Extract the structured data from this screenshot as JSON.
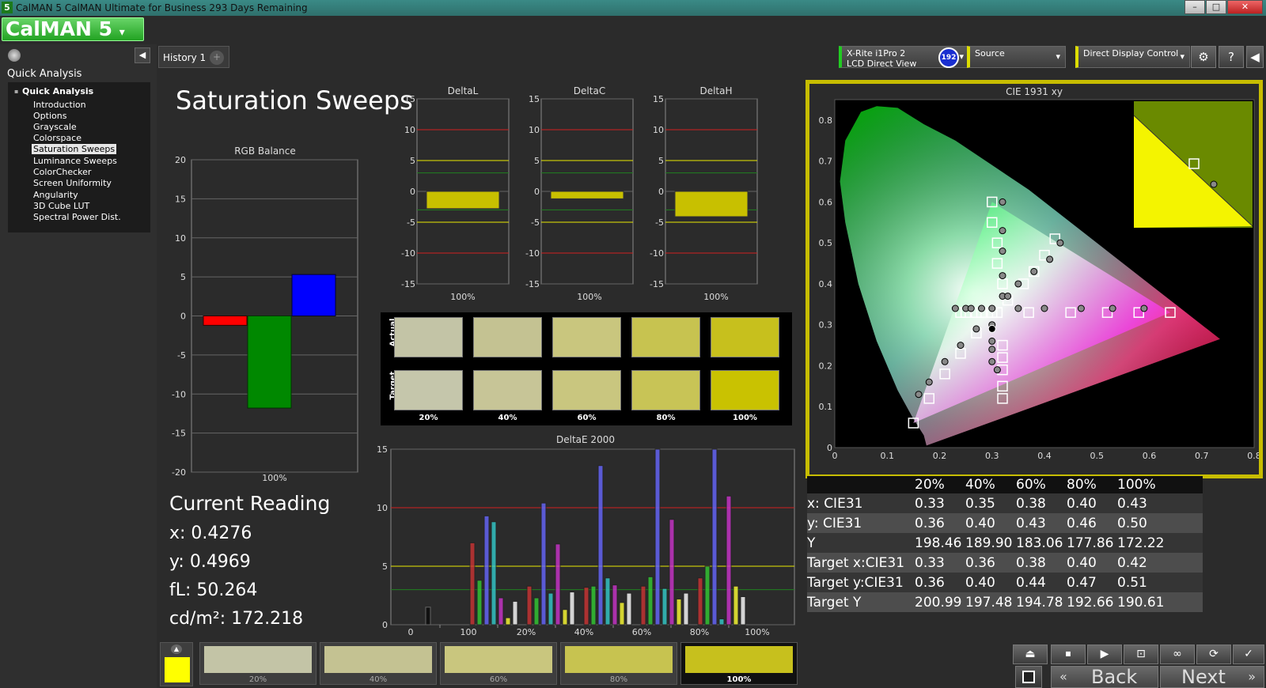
{
  "window": {
    "title": "CalMAN 5 CalMAN Ultimate for Business 293 Days Remaining",
    "icon_label": "5",
    "min_label": "–",
    "max_label": "□",
    "close_label": "✕"
  },
  "app": {
    "logo": "CalMAN 5"
  },
  "sidebar": {
    "header": "Quick Analysis",
    "tree_root": "Quick Analysis",
    "items": [
      "Introduction",
      "Options",
      "Grayscale",
      "Colorspace",
      "Saturation Sweeps",
      "Luminance Sweeps",
      "ColorChecker",
      "Screen Uniformity",
      "Angularity",
      "3D Cube LUT",
      "Spectral Power Dist."
    ],
    "selected": "Saturation Sweeps"
  },
  "tabs": {
    "history": "History 1",
    "add": "+"
  },
  "devices": {
    "meter_line1": "X-Rite i1Pro 2",
    "meter_line2": "LCD Direct View",
    "badge": "192",
    "source": "Source",
    "display": "Direct Display Control"
  },
  "page": {
    "title": "Saturation Sweeps"
  },
  "rgb_balance": {
    "title": "RGB Balance",
    "xlabel": "100%",
    "ticks": [
      "20",
      "15",
      "10",
      "5",
      "0",
      "-5",
      "-10",
      "-15",
      "-20"
    ]
  },
  "delta_charts": {
    "ticks": [
      "15",
      "10",
      "5",
      "0",
      "-5",
      "-10",
      "-15"
    ],
    "L": {
      "title": "DeltaL",
      "xlabel": "100%"
    },
    "C": {
      "title": "DeltaC",
      "xlabel": "100%"
    },
    "H": {
      "title": "DeltaH",
      "xlabel": "100%"
    }
  },
  "swatches": {
    "actual_label": "Actual",
    "target_label": "Target",
    "labels": [
      "20%",
      "40%",
      "60%",
      "80%",
      "100%"
    ],
    "actual_colors": [
      "#c3c4a6",
      "#c4c292",
      "#c9c67e",
      "#c7c350",
      "#c7c01d"
    ],
    "target_colors": [
      "#c5c6ab",
      "#c7c597",
      "#c9c67f",
      "#c8c456",
      "#c9c201"
    ]
  },
  "deltae": {
    "title": "DeltaE 2000",
    "xticks": [
      "0",
      "100",
      "20%",
      "40%",
      "60%",
      "80%",
      "100%"
    ],
    "yticks": [
      "15",
      "10",
      "5",
      "0"
    ]
  },
  "cie": {
    "title": "CIE 1931 xy",
    "xticks": [
      "0",
      "0.1",
      "0.2",
      "0.3",
      "0.4",
      "0.5",
      "0.6",
      "0.7",
      "0.8"
    ],
    "yticks": [
      "0.8",
      "0.7",
      "0.6",
      "0.5",
      "0.4",
      "0.3",
      "0.2",
      "0.1",
      "0"
    ]
  },
  "current_reading": {
    "title": "Current Reading",
    "x": "x: 0.4276",
    "y": "y: 0.4969",
    "fl": "fL: 50.264",
    "cd": "cd/m²: 172.218"
  },
  "table": {
    "headers": [
      "20%",
      "40%",
      "60%",
      "80%",
      "100%"
    ],
    "rows": [
      {
        "label": "x: CIE31",
        "values": [
          "0.33",
          "0.35",
          "0.38",
          "0.40",
          "0.43"
        ]
      },
      {
        "label": "y: CIE31",
        "values": [
          "0.36",
          "0.40",
          "0.43",
          "0.46",
          "0.50"
        ]
      },
      {
        "label": "Y",
        "values": [
          "198.46",
          "189.90",
          "183.06",
          "177.86",
          "172.22"
        ]
      },
      {
        "label": "Target x:CIE31",
        "values": [
          "0.33",
          "0.36",
          "0.38",
          "0.40",
          "0.42"
        ]
      },
      {
        "label": "Target y:CIE31",
        "values": [
          "0.36",
          "0.40",
          "0.44",
          "0.47",
          "0.51"
        ]
      },
      {
        "label": "Target Y",
        "values": [
          "200.99",
          "197.48",
          "194.78",
          "192.66",
          "190.61"
        ]
      }
    ]
  },
  "bottom": {
    "labels": [
      "20%",
      "40%",
      "60%",
      "80%",
      "100%"
    ],
    "colors": [
      "#c3c4a6",
      "#c4c292",
      "#c9c67e",
      "#c7c350",
      "#c7c01d"
    ],
    "current_color": "#ffff00",
    "back": "Back",
    "next": "Next"
  },
  "chart_data": [
    {
      "type": "bar",
      "title": "RGB Balance",
      "categories": [
        "100%"
      ],
      "series": [
        {
          "values": [
            -1.2
          ]
        },
        {
          "values": [
            -11.8
          ]
        },
        {
          "values": [
            5.3
          ]
        }
      ],
      "colors": [
        "#ff0000",
        "#008800",
        "#0000ff"
      ],
      "ylim": [
        -20,
        20
      ]
    },
    {
      "type": "bar",
      "title": "DeltaL",
      "categories": [
        "100%"
      ],
      "values": [
        -2.8
      ],
      "ylim": [
        -15,
        15
      ]
    },
    {
      "type": "bar",
      "title": "DeltaC",
      "categories": [
        "100%"
      ],
      "values": [
        -1.2
      ],
      "ylim": [
        -15,
        15
      ]
    },
    {
      "type": "bar",
      "title": "DeltaH",
      "categories": [
        "100%"
      ],
      "values": [
        -4.1
      ],
      "ylim": [
        -15,
        15
      ]
    },
    {
      "type": "bar",
      "title": "DeltaE 2000",
      "ylim": [
        0,
        15
      ],
      "groups": [
        {
          "values": [
            1.5
          ]
        },
        {
          "values": [
            7.0,
            3.8,
            9.3,
            8.8,
            2.3,
            0.6,
            2.0
          ]
        },
        {
          "values": [
            3.3,
            2.3,
            10.4,
            2.7,
            6.9,
            1.3,
            2.8
          ]
        },
        {
          "values": [
            3.2,
            3.3,
            13.6,
            4.0,
            3.4,
            1.9,
            2.7
          ]
        },
        {
          "values": [
            3.3,
            4.1,
            15.0,
            3.1,
            9.0,
            2.2,
            2.7
          ]
        },
        {
          "values": [
            4.0,
            5.0,
            15.0,
            0.5,
            11.0,
            3.3,
            2.4
          ]
        }
      ],
      "colors": [
        "#cc3333",
        "#33cc33",
        "#6666ff",
        "#33cccc",
        "#cc33cc",
        "#ffff33",
        "#ffffff"
      ]
    },
    {
      "type": "scatter",
      "title": "CIE 1931 xy",
      "xlim": [
        0,
        0.8
      ],
      "ylim": [
        0,
        0.85
      ],
      "gamut": [
        [
          0.64,
          0.33
        ],
        [
          0.3,
          0.6
        ],
        [
          0.15,
          0.06
        ]
      ],
      "targets": [
        [
          0.15,
          0.06
        ],
        [
          0.18,
          0.12
        ],
        [
          0.21,
          0.18
        ],
        [
          0.24,
          0.23
        ],
        [
          0.27,
          0.28
        ],
        [
          0.3,
          0.6
        ],
        [
          0.3,
          0.55
        ],
        [
          0.31,
          0.5
        ],
        [
          0.31,
          0.45
        ],
        [
          0.32,
          0.4
        ],
        [
          0.31,
          0.33
        ],
        [
          0.64,
          0.33
        ],
        [
          0.58,
          0.33
        ],
        [
          0.52,
          0.33
        ],
        [
          0.45,
          0.33
        ],
        [
          0.37,
          0.33
        ],
        [
          0.24,
          0.33
        ],
        [
          0.25,
          0.33
        ],
        [
          0.27,
          0.33
        ],
        [
          0.28,
          0.33
        ],
        [
          0.3,
          0.33
        ],
        [
          0.32,
          0.12
        ],
        [
          0.32,
          0.15
        ],
        [
          0.32,
          0.19
        ],
        [
          0.32,
          0.22
        ],
        [
          0.32,
          0.25
        ],
        [
          0.42,
          0.51
        ],
        [
          0.4,
          0.47
        ],
        [
          0.38,
          0.43
        ],
        [
          0.36,
          0.4
        ],
        [
          0.33,
          0.36
        ]
      ],
      "actuals": [
        [
          0.16,
          0.13
        ],
        [
          0.18,
          0.16
        ],
        [
          0.21,
          0.21
        ],
        [
          0.24,
          0.25
        ],
        [
          0.27,
          0.29
        ],
        [
          0.32,
          0.6
        ],
        [
          0.32,
          0.53
        ],
        [
          0.32,
          0.48
        ],
        [
          0.32,
          0.42
        ],
        [
          0.32,
          0.37
        ],
        [
          0.59,
          0.34
        ],
        [
          0.53,
          0.34
        ],
        [
          0.47,
          0.34
        ],
        [
          0.4,
          0.34
        ],
        [
          0.35,
          0.34
        ],
        [
          0.23,
          0.34
        ],
        [
          0.25,
          0.34
        ],
        [
          0.26,
          0.34
        ],
        [
          0.28,
          0.34
        ],
        [
          0.3,
          0.34
        ],
        [
          0.3,
          0.3
        ],
        [
          0.3,
          0.26
        ],
        [
          0.3,
          0.24
        ],
        [
          0.3,
          0.21
        ],
        [
          0.31,
          0.19
        ],
        [
          0.43,
          0.5
        ],
        [
          0.41,
          0.46
        ],
        [
          0.38,
          0.43
        ],
        [
          0.35,
          0.4
        ],
        [
          0.33,
          0.37
        ]
      ],
      "current": [
        0.3,
        0.29
      ]
    }
  ]
}
